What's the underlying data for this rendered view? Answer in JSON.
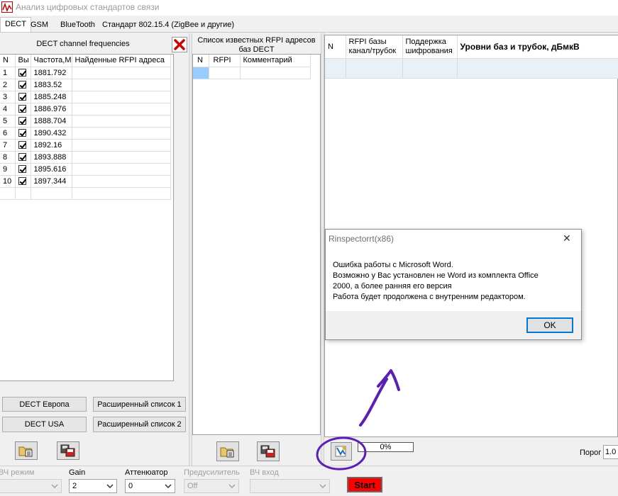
{
  "window": {
    "title": "Анализ цифровых стандартов связи"
  },
  "tabs": [
    {
      "label": "DECT",
      "active": true
    },
    {
      "label": "GSM"
    },
    {
      "label": "BlueTooth"
    },
    {
      "label": "Стандарт 802.15.4 (ZigBee и другие)"
    }
  ],
  "freq_panel": {
    "title": "DECT channel frequencies",
    "columns": [
      "N",
      "Вы",
      "Частота,М",
      "Найденные RFPI адреса"
    ],
    "rows": [
      {
        "n": "1",
        "freq": "1881.792"
      },
      {
        "n": "2",
        "freq": "1883.52"
      },
      {
        "n": "3",
        "freq": "1885.248"
      },
      {
        "n": "4",
        "freq": "1886.976"
      },
      {
        "n": "5",
        "freq": "1888.704"
      },
      {
        "n": "6",
        "freq": "1890.432"
      },
      {
        "n": "7",
        "freq": "1892.16"
      },
      {
        "n": "8",
        "freq": "1893.888"
      },
      {
        "n": "9",
        "freq": "1895.616"
      },
      {
        "n": "10",
        "freq": "1897.344"
      }
    ],
    "buttons": {
      "dect_europe": "DECT Европа",
      "extended_1": "Расширенный список 1",
      "dect_usa": "DECT USA",
      "extended_2": "Расширенный список 2"
    }
  },
  "rfpi_panel": {
    "title_line1": "Список известных RFPI адресов",
    "title_line2": "баз DECT",
    "columns": [
      "N",
      "RFPI",
      "Комментарий"
    ]
  },
  "levels_panel": {
    "col_n": "N",
    "col_rfpi_1": "RFPI базы",
    "col_rfpi_2": "канал/трубок",
    "col_enc_1": "Поддержка",
    "col_enc_2": "шифрования",
    "col_levels": "Уровни баз и трубок, дБмкВ"
  },
  "progress": {
    "text": "0%",
    "value": 0
  },
  "threshold": {
    "label": "Порог",
    "value": "1.0"
  },
  "bottom": {
    "rf_mode_label": "ВЧ режим",
    "gain_label": "Gain",
    "gain_value": "2",
    "attenuator_label": "Аттенюатор",
    "attenuator_value": "0",
    "preamp_label": "Предусилитель",
    "preamp_value": "Off",
    "rf_input_label": "ВЧ вход",
    "start_label": "Start"
  },
  "dialog": {
    "title": "Rinspectorrt(x86)",
    "line1": "Ошибка работы с Microsoft Word.",
    "line2": "Возможно у Вас установлен не Word из комплекта Office",
    "line3": "2000, а более ранняя его версия",
    "line4": "Работа будет продолжена с внутренним редактором.",
    "ok": "OK",
    "close": "✕"
  },
  "colors": {
    "start_button": "#ff0000",
    "annotation_ink": "#5a1fb4",
    "selected_cell": "#99ccff",
    "ok_border": "#0078d7"
  }
}
